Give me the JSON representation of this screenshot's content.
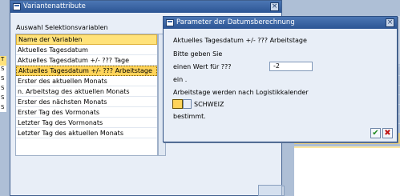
{
  "background": {
    "left_items": [
      "T",
      "S",
      "S",
      "S",
      "S",
      "S"
    ]
  },
  "variant_window": {
    "title": "Variantenattribute",
    "section_label": "Auswahl Selektionsvariablen",
    "list_header": "Name der Variablen",
    "items": [
      "Aktuelles Tagesdatum",
      "Aktuelles Tagesdatum +/- ??? Tage",
      "Aktuelles Tagesdatum +/- ??? Arbeitstage",
      "Erster des aktuellen Monats",
      "n. Arbeitstag des aktuellen Monats",
      "Erster des nächsten Monats",
      "Erster Tag des Vormonats",
      "Letzter Tag des Vormonats",
      "Letzter Tag des aktuellen Monats"
    ],
    "selected_index": 2
  },
  "param_dialog": {
    "title": "Parameter der Datumsberechnung",
    "heading": "Aktuelles Tagesdatum +/- ??? Arbeitstage",
    "prompt": "Bitte geben Sie",
    "value_label": "einen Wert für ???",
    "value": "-2",
    "suffix": "ein .",
    "calendar_text": "Arbeitstage werden nach Logistikkalender",
    "calendar_value": "SCHWEIZ",
    "determined": "bestimmt."
  },
  "colors": {
    "title_bar": "#2c5594",
    "selection": "#ffd45a",
    "dialog_bg": "#e8eef7",
    "ok": "#1f8a1f",
    "cancel": "#c01515"
  },
  "icons": {
    "ok": "checkmark-icon",
    "cancel": "cancel-icon",
    "close": "close-icon"
  }
}
